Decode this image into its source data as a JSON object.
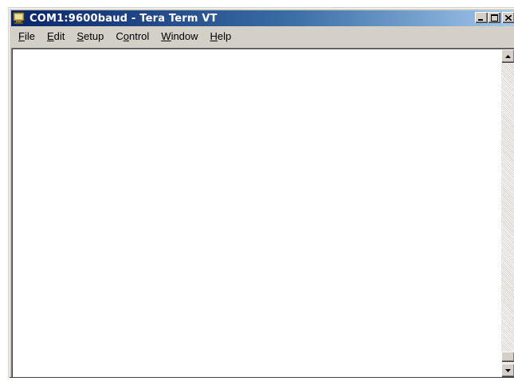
{
  "window": {
    "title": "COM1:9600baud - Tera Term VT"
  },
  "menu": {
    "items": [
      {
        "key": "F",
        "rest": "ile"
      },
      {
        "key": "E",
        "rest": "dit"
      },
      {
        "key": "S",
        "rest": "etup"
      },
      {
        "key": "o",
        "pre": "C",
        "rest": "ntrol"
      },
      {
        "key": "W",
        "rest": "indow"
      },
      {
        "key": "H",
        "rest": "elp"
      }
    ]
  },
  "colors": {
    "titlebar_start": "#0a246a",
    "titlebar_end": "#a6caf0",
    "chrome": "#d4d0c8",
    "terminal_bg": "#ffffff"
  },
  "icons": {
    "app": "tera-term-icon",
    "minimize": "minimize-icon",
    "maximize": "maximize-icon",
    "close": "close-icon",
    "scroll_up": "arrow-up-icon",
    "scroll_down": "arrow-down-icon"
  }
}
